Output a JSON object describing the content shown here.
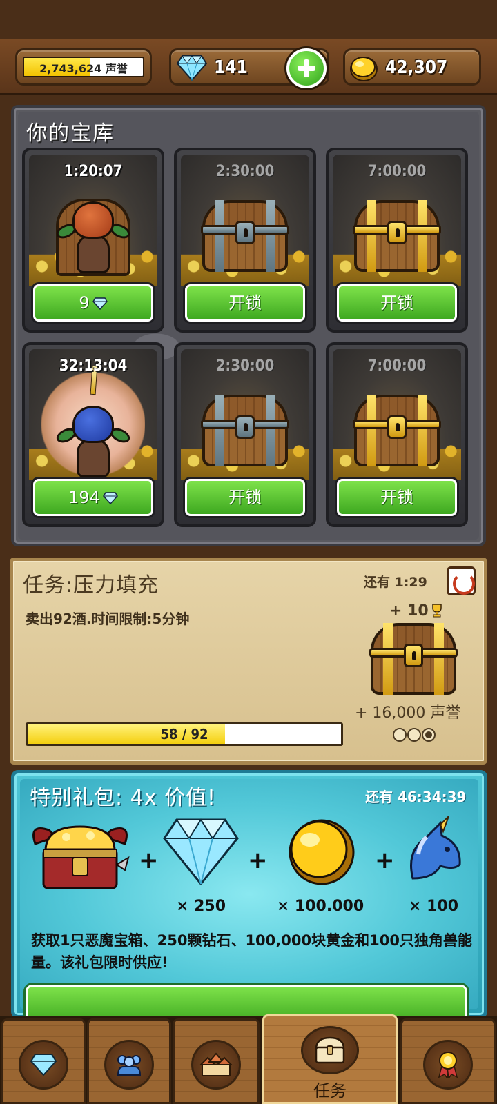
{
  "header": {
    "reputation": {
      "value": "2,743,624",
      "unit": "声誉",
      "fill_fraction": 0.55
    },
    "gems": {
      "value": "141"
    },
    "gold": {
      "value": "42,307"
    }
  },
  "vault": {
    "title": "你的宝库",
    "slots": [
      {
        "timer": "1:20:07",
        "button": "9",
        "button_icon": "gem-icon",
        "content": "guarded-chest-red"
      },
      {
        "timer": "2:30:00",
        "button": "开锁",
        "content": "iron-chest"
      },
      {
        "timer": "7:00:00",
        "button": "开锁",
        "content": "gold-chest"
      },
      {
        "timer": "32:13:04",
        "button": "194",
        "button_icon": "gem-icon",
        "content": "guarded-chest-blue"
      },
      {
        "timer": "2:30:00",
        "button": "开锁",
        "content": "iron-chest"
      },
      {
        "timer": "7:00:00",
        "button": "开锁",
        "content": "gold-chest"
      }
    ]
  },
  "quest": {
    "title": "任务:压力填充",
    "description": "卖出92酒.时间限制:5分钟",
    "time_left": "还有 1:29",
    "reward_cups": "+ 10",
    "reward_rep": "+ 16,000 声誉",
    "progress": {
      "current": 58,
      "total": 92,
      "text": "58 / 92"
    },
    "stage_dots": 3,
    "active_dot": 3
  },
  "offer": {
    "title": "特别礼包: 4x 价值!",
    "time_left": "还有 46:34:39",
    "items": [
      {
        "name": "demon-chest",
        "qty": ""
      },
      {
        "name": "diamond",
        "qty": "× 250"
      },
      {
        "name": "gold-coin",
        "qty": "× 100.000"
      },
      {
        "name": "unicorn",
        "qty": "× 100"
      }
    ],
    "description": "获取1只恶魔宝箱、250颗钻石、100,000块黄金和100只独角兽能量。该礼包限时供应!"
  },
  "nav": {
    "tabs": [
      {
        "icon": "gem-icon",
        "label": ""
      },
      {
        "icon": "people-icon",
        "label": ""
      },
      {
        "icon": "buildings-icon",
        "label": ""
      },
      {
        "icon": "chest-icon",
        "label": "任务",
        "active": true
      },
      {
        "icon": "medal-icon",
        "label": ""
      }
    ]
  },
  "colors": {
    "accent_green": "#3ea820",
    "wood": "#7a4a24",
    "offer_teal": "#2a9fb4",
    "progress_yellow": "#f4cf0f"
  }
}
